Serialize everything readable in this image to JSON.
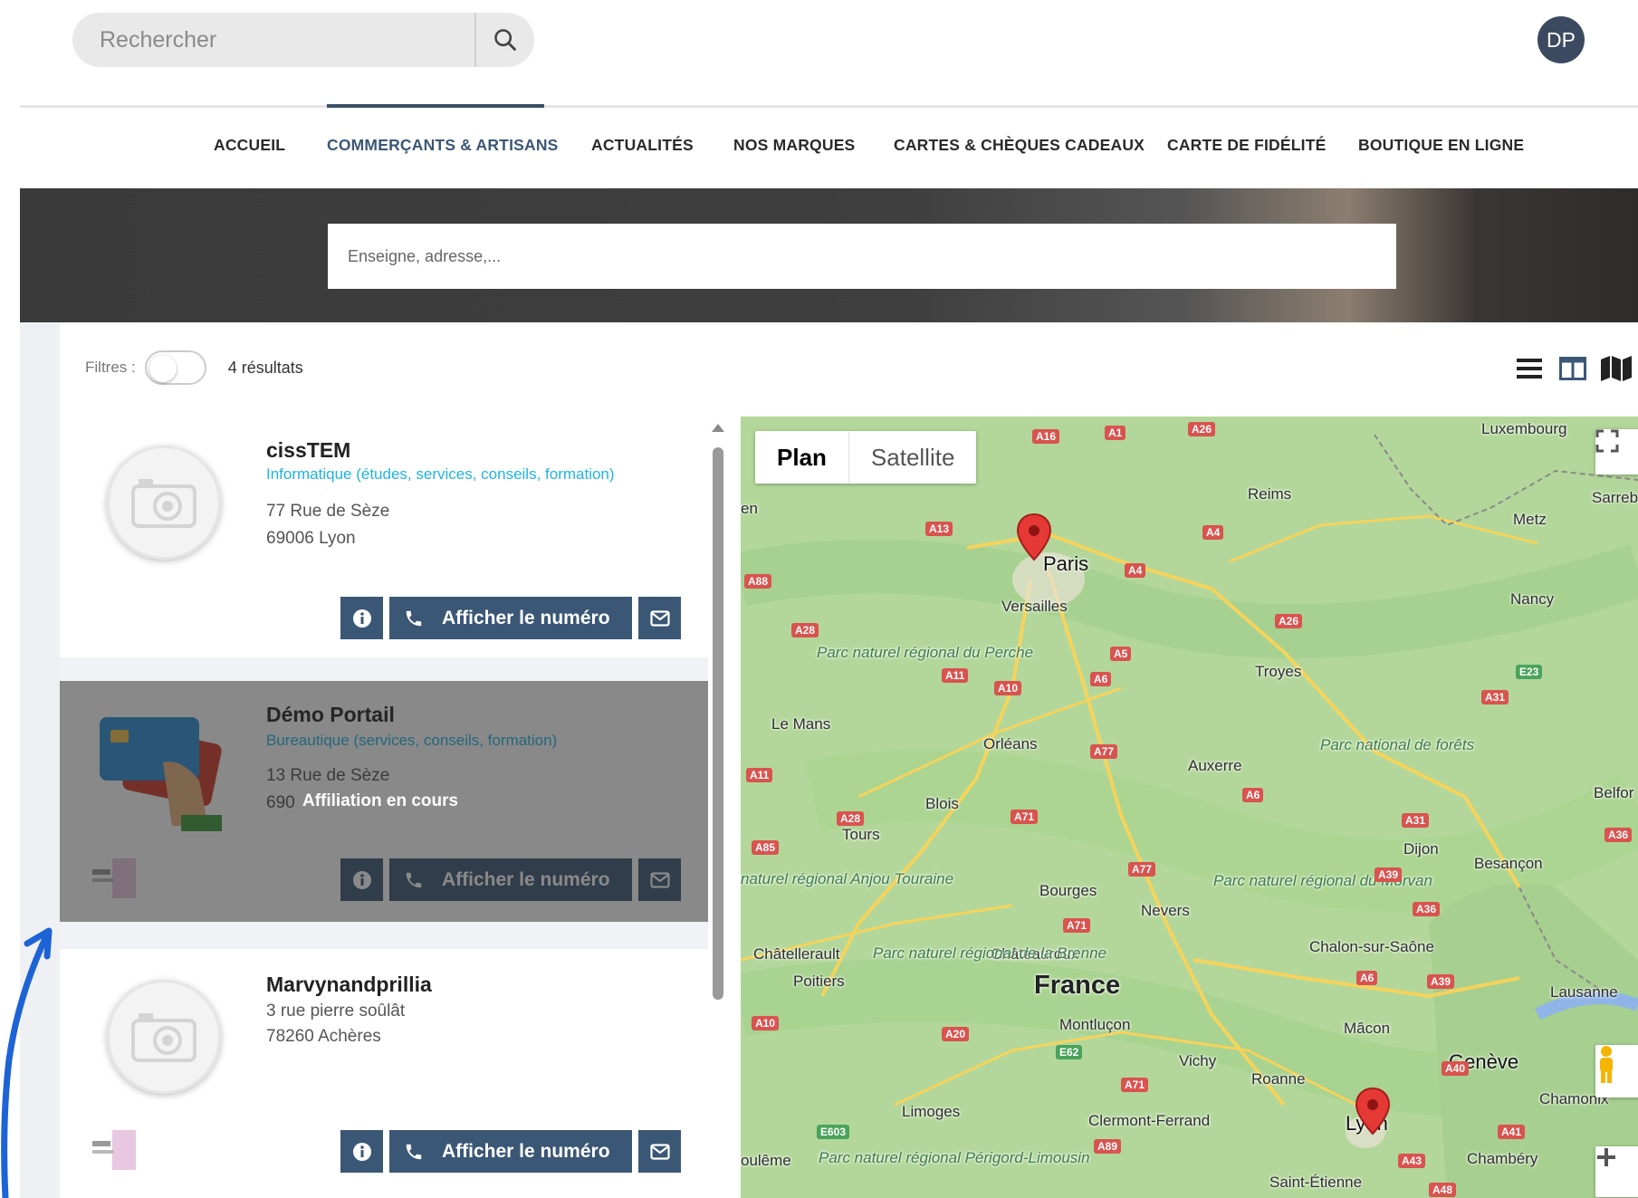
{
  "header": {
    "search_placeholder": "Rechercher",
    "avatar_initials": "DP"
  },
  "nav": {
    "items": [
      {
        "label": "ACCUEIL"
      },
      {
        "label": "COMMERÇANTS & ARTISANS"
      },
      {
        "label": "ACTUALITÉS"
      },
      {
        "label": "NOS MARQUES"
      },
      {
        "label": "CARTES & CHÈQUES CADEAUX"
      },
      {
        "label": "CARTE DE FIDÉLITÉ"
      },
      {
        "label": "BOUTIQUE EN LIGNE"
      }
    ],
    "active_index": 1
  },
  "hero": {
    "search_placeholder": "Enseigne, adresse,..."
  },
  "filters": {
    "label": "Filtres :",
    "toggle_on": false,
    "results": "4 résultats"
  },
  "listings": [
    {
      "name": "cissTEM",
      "category": "Informatique (études, services, conseils, formation)",
      "address_line1": "77 Rue de Sèze",
      "address_line2": "69006 Lyon",
      "phone_label": "Afficher le numéro"
    },
    {
      "name": "Démo Portail",
      "category": "Bureautique (services, conseils, formation)",
      "address_line1": "13 Rue de Sèze",
      "address_line2": "690",
      "status": "Affiliation en cours",
      "phone_label": "Afficher le numéro"
    },
    {
      "name": "Marvynandprillia",
      "address_line1": "3 rue pierre soûlât",
      "address_line2": "78260 Achères",
      "phone_label": "Afficher le numéro"
    }
  ],
  "map": {
    "type_plan": "Plan",
    "type_satellite": "Satellite",
    "country": "France",
    "cities": [
      "Paris",
      "Versailles",
      "Reims",
      "Metz",
      "Nancy",
      "Luxembourg",
      "Sarreb",
      "Troyes",
      "Le Mans",
      "Orléans",
      "Auxerre",
      "Blois",
      "Tours",
      "Dijon",
      "Besançon",
      "Belfor",
      "Bourges",
      "Nevers",
      "Châtellerault",
      "Châteauroux",
      "Poitiers",
      "Chalon-sur-Saône",
      "Lausanne",
      "Montluçon",
      "Mâcon",
      "Genève",
      "Vichy",
      "Roanne",
      "Limoges",
      "Clermont-Ferrand",
      "Lyon",
      "Chamonix",
      "Chambéry",
      "Saint-Étienne",
      "oulême",
      "en"
    ],
    "parks": [
      "Parc naturel régional du Perche",
      "Parc national de forêts",
      "naturel régional Anjou Touraine",
      "Parc naturel régional du Morvan",
      "Parc naturel régional de la Brenne",
      "Parc naturel régional Périgord-Limousin"
    ],
    "roads": [
      "A16",
      "A1",
      "A26",
      "A13",
      "A4",
      "A88",
      "A28",
      "A11",
      "A10",
      "A4",
      "A5",
      "A6",
      "A77",
      "A26",
      "A31",
      "E23",
      "A11",
      "A28",
      "A71",
      "A85",
      "A77",
      "A6",
      "A31",
      "A39",
      "A36",
      "A71",
      "A36",
      "A6",
      "A39",
      "A10",
      "A20",
      "E62",
      "A71",
      "A40",
      "E603",
      "A89",
      "A41",
      "A43",
      "A48"
    ],
    "pins": [
      "Paris",
      "Lyon"
    ]
  },
  "colors": {
    "primary": "#3b5776",
    "category": "#1fb3e5",
    "avatar": "#3c4a61",
    "pin": "#e53935"
  }
}
